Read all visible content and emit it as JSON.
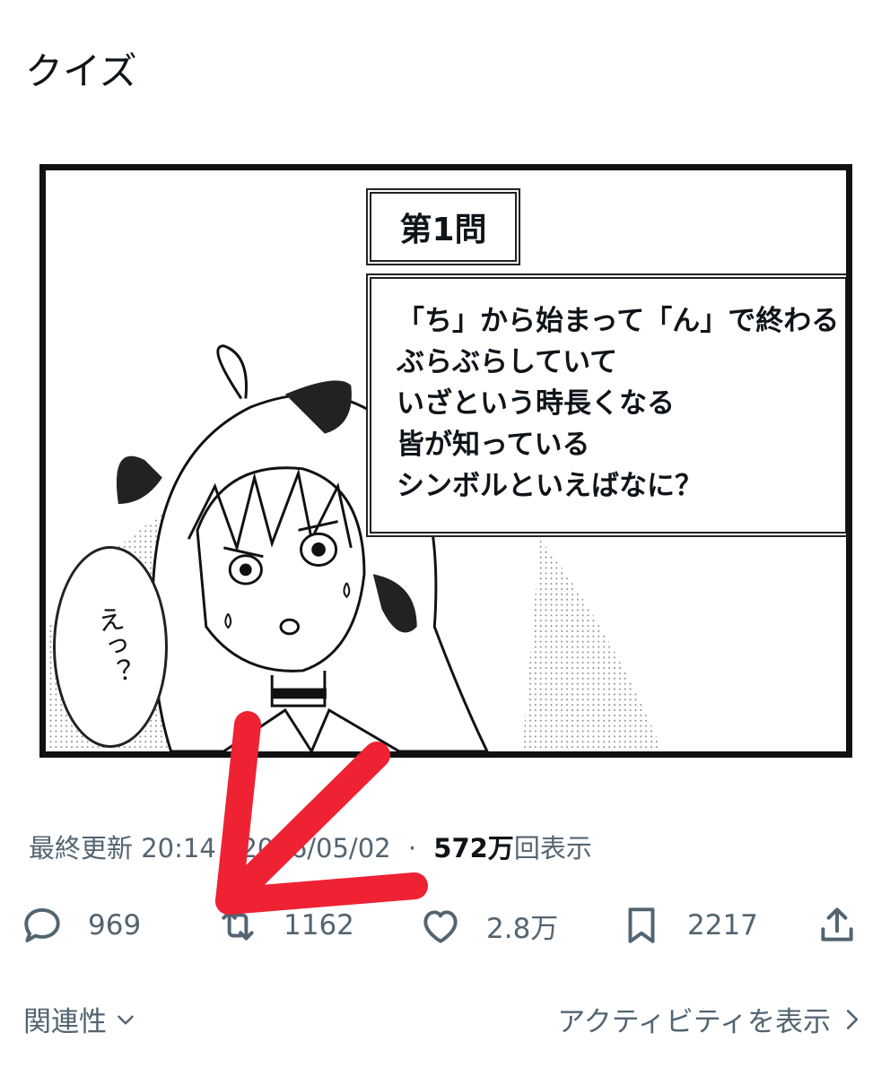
{
  "post": {
    "text": "クイズ"
  },
  "media": {
    "question_header": "第1問",
    "question_lines": [
      "「ち」から始まって「ん」で終わる",
      "ぶらぶらしていて",
      "いざという時長くなる",
      "皆が知っている",
      "シンボルといえばなに？"
    ],
    "speech_bubble": "えっ？"
  },
  "meta": {
    "updated_label": "最終更新",
    "timestamp": "20:14 · 2026/05/02",
    "separator": "·",
    "views_count": "572万",
    "views_label": "回表示"
  },
  "actions": {
    "reply_count": "969",
    "retweet_count": "1162",
    "like_count": "2.8万",
    "bookmark_count": "2217"
  },
  "footer": {
    "sort_label": "関連性",
    "activity_label": "アクティビティを表示"
  },
  "colors": {
    "text_primary": "#0f1419",
    "text_secondary": "#536471",
    "annotation_arrow": "#ee2233"
  },
  "icons": [
    "reply-icon",
    "retweet-icon",
    "like-icon",
    "bookmark-icon",
    "share-icon",
    "chevron-down-icon",
    "chevron-right-icon"
  ]
}
